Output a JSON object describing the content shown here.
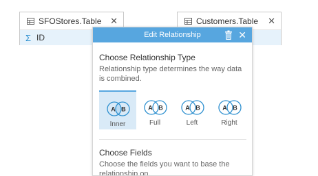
{
  "left_card": {
    "title": "SFOStores.Table",
    "close": "✕",
    "field_icon": "Σ",
    "field": "ID"
  },
  "right_card": {
    "title": "Customers.Table",
    "close": "✕"
  },
  "dialog": {
    "title": "Edit Relationship",
    "close": "✕",
    "relationship_type": {
      "heading": "Choose Relationship Type",
      "description": "Relationship type determines the way data is combined."
    },
    "types": [
      {
        "label": "Inner",
        "a": "A",
        "b": "B",
        "selected": true
      },
      {
        "label": "Full",
        "a": "A",
        "b": "B",
        "selected": false
      },
      {
        "label": "Left",
        "a": "A",
        "b": "B",
        "selected": false
      },
      {
        "label": "Right",
        "a": "A",
        "b": "B",
        "selected": false
      }
    ],
    "fields": {
      "heading": "Choose Fields",
      "description": "Choose the fields you want to base the relationship on."
    }
  },
  "colors": {
    "accent": "#57a6df",
    "selected_bg": "#d9eaf7",
    "venn_stroke": "#2c8fcf"
  },
  "icons": [
    "table-icon",
    "sigma-icon",
    "trash-icon",
    "close-icon",
    "venn-icon"
  ]
}
